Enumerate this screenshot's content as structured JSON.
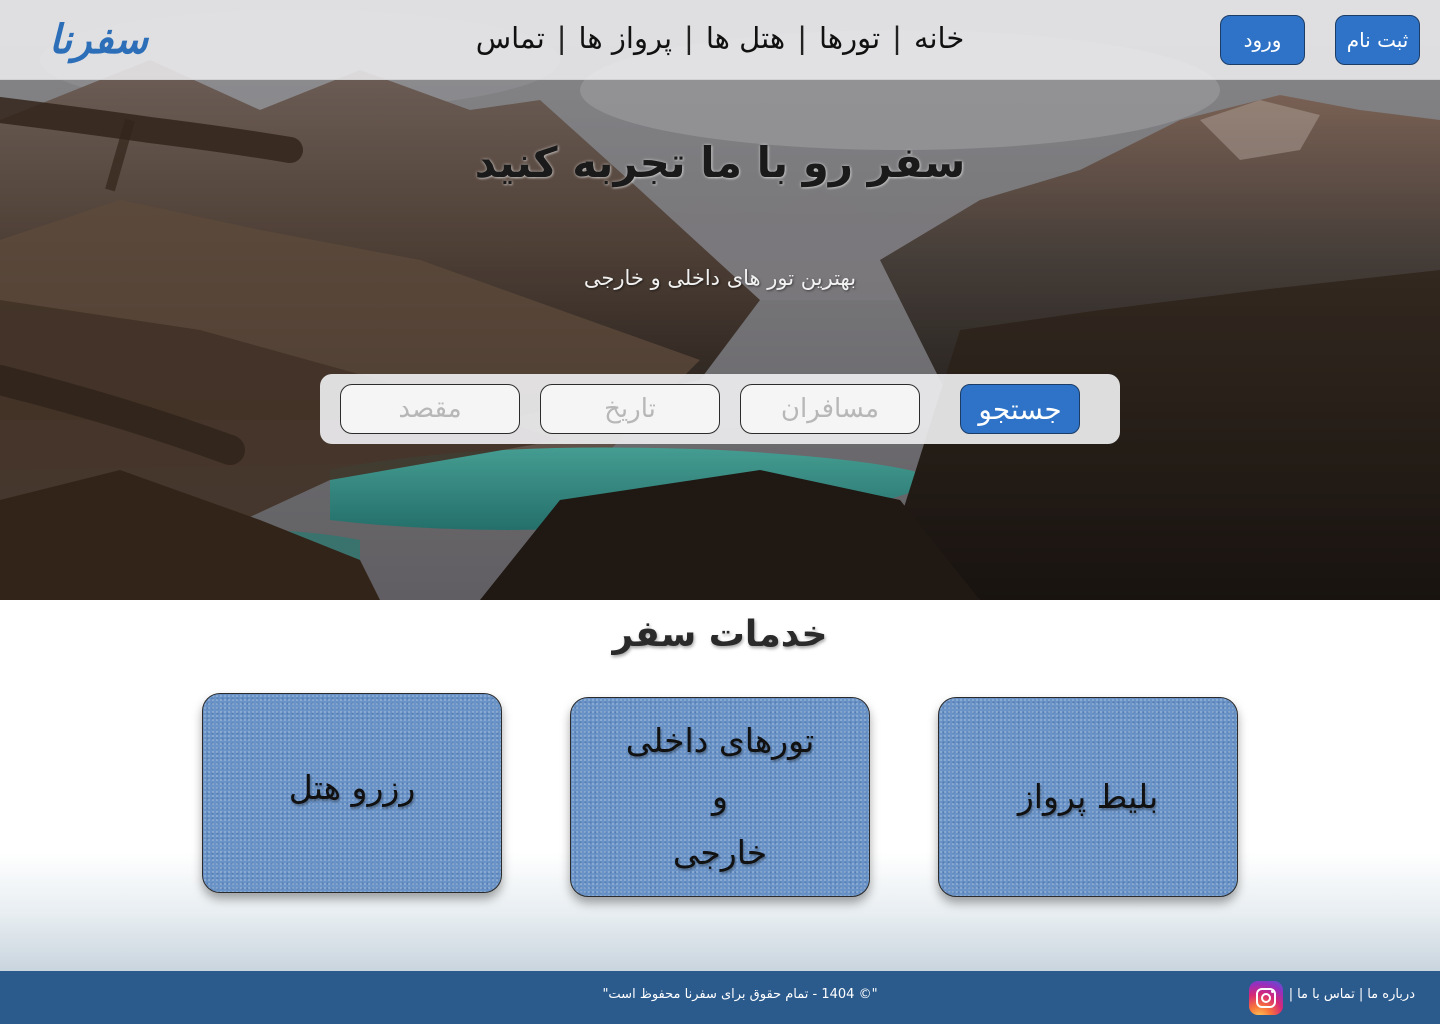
{
  "brand": {
    "logo_text": "سفرنا",
    "color": "#2c6fb8"
  },
  "nav": {
    "home": "خانه",
    "tours": "تورها",
    "hotels": "هتل ها",
    "flights": "پرواز ها",
    "contact": "تماس",
    "separator": "|"
  },
  "auth": {
    "register_label": "ثبت نام",
    "login_label": "ورود"
  },
  "hero": {
    "title": "سفر رو با ما تجربه کنید",
    "subtitle": "بهترین تور های داخلی و خارجی",
    "background": "mountain-lake-forest-photo"
  },
  "search": {
    "destination_placeholder": "مقصد",
    "date_placeholder": "تاریخ",
    "passengers_placeholder": "مسافران",
    "search_label": "جستجو"
  },
  "services": {
    "title": "خدمات سفر",
    "items": [
      {
        "label": "رزرو هتل"
      },
      {
        "label": "تورهای داخلی\nو\nخارجی"
      },
      {
        "label": "بلیط پرواز"
      }
    ]
  },
  "footer": {
    "copyright": "\"© 1404 - تمام حقوق برای سفرنا محفوظ است\"",
    "about": "درباره ما",
    "contact_us": "تماس با ما",
    "separator": "|",
    "social_icon": "instagram-icon"
  },
  "colors": {
    "accent": "#2e73c8",
    "footer": "#2b5a8c",
    "card": "#6a93c7"
  }
}
